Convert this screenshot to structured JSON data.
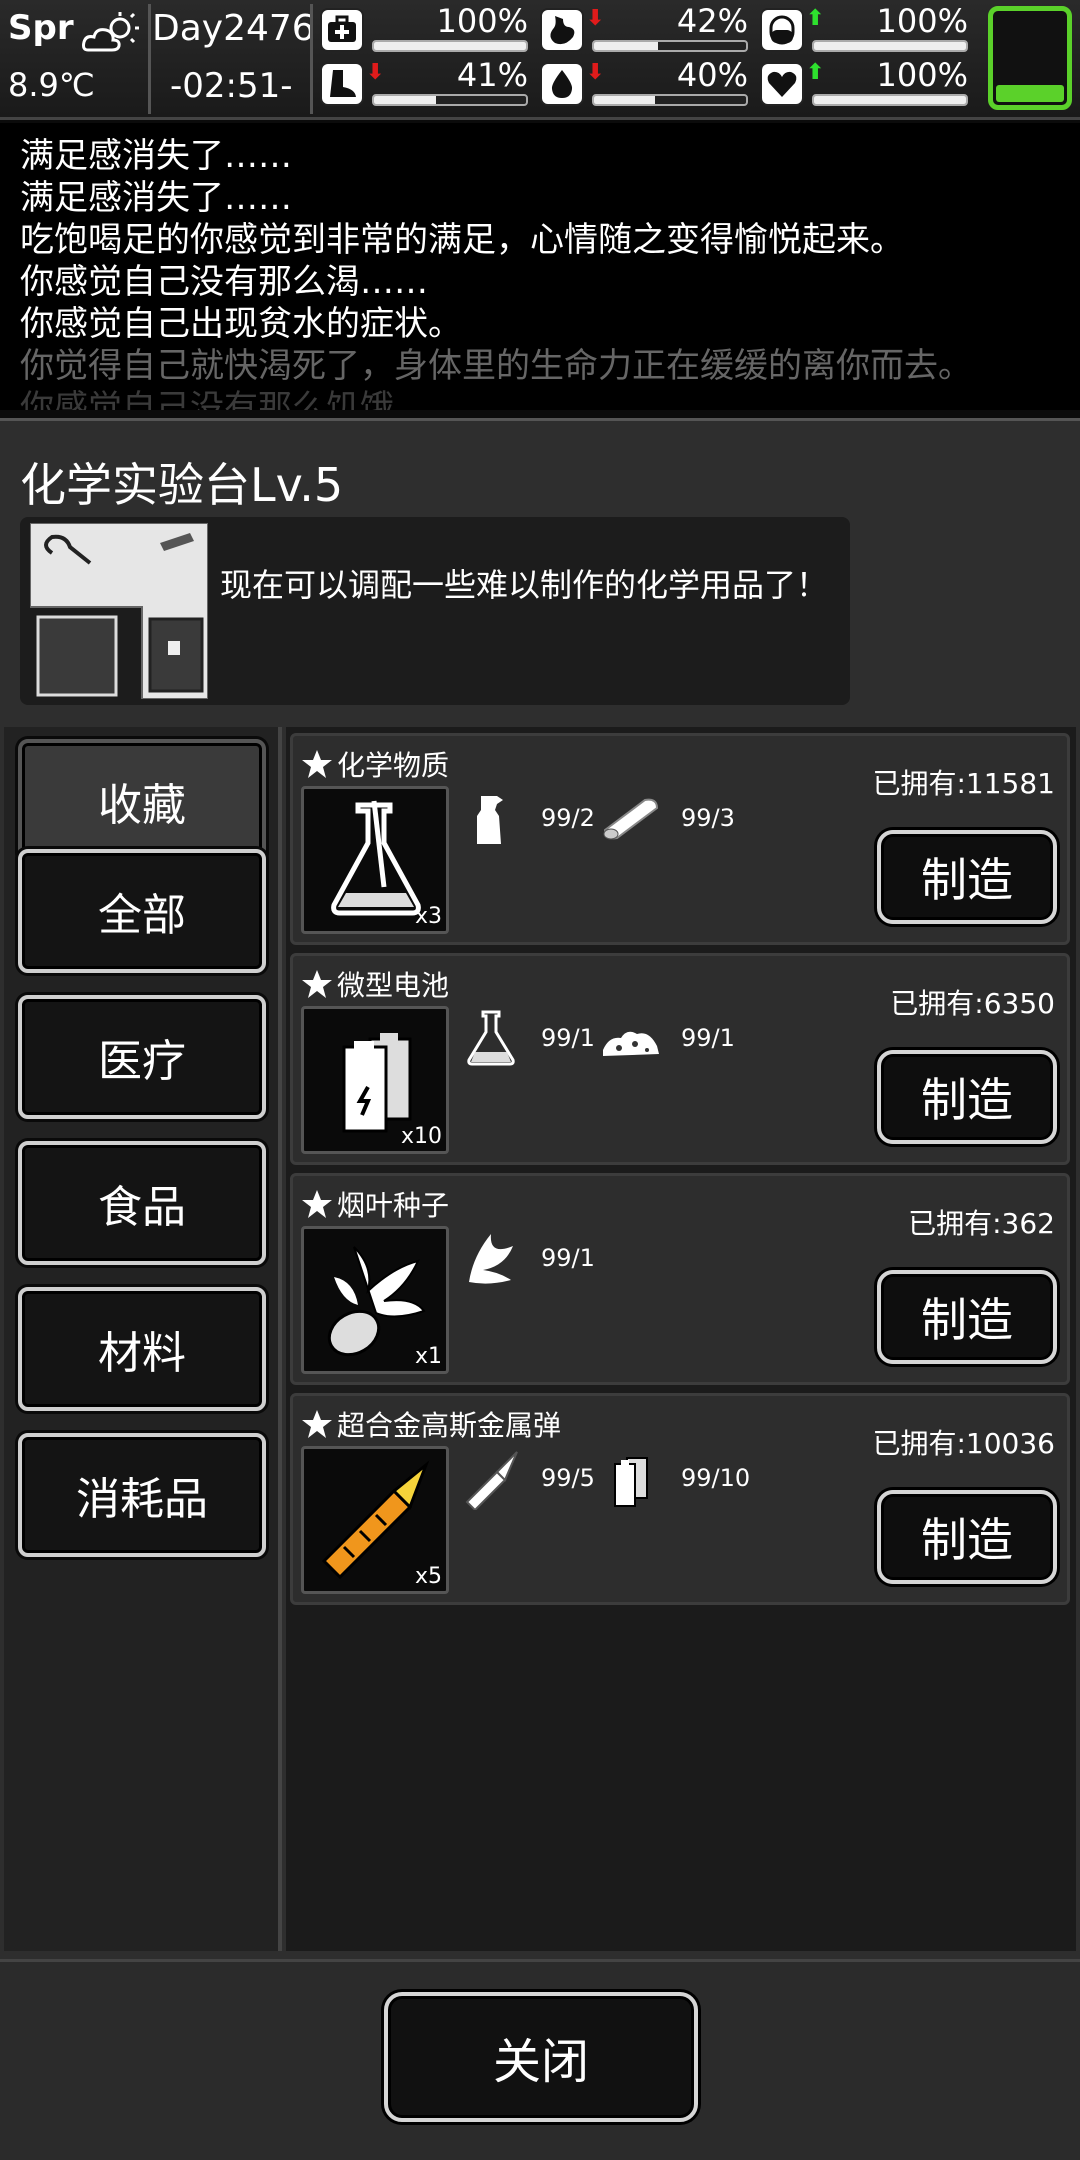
{
  "status": {
    "season": "Spr",
    "temperature": "8.9℃",
    "day": "Day2476",
    "time": "-02:51-",
    "stats": [
      {
        "name": "health",
        "value": "100%",
        "fill": 1.0,
        "trend": ""
      },
      {
        "name": "hunger",
        "value": "42%",
        "fill": 0.42,
        "trend": "down"
      },
      {
        "name": "mood",
        "value": "100%",
        "fill": 1.0,
        "trend": "up"
      },
      {
        "name": "stamina",
        "value": "41%",
        "fill": 0.41,
        "trend": "down"
      },
      {
        "name": "thirst",
        "value": "40%",
        "fill": 0.4,
        "trend": "down"
      },
      {
        "name": "heart",
        "value": "100%",
        "fill": 1.0,
        "trend": "up"
      }
    ],
    "battery_level": 0.18,
    "colors": {
      "battery": "#5bd12a",
      "up": "#2ee02e",
      "down": "#e01b1b"
    }
  },
  "log": [
    "满足感消失了……",
    "满足感消失了……",
    "吃饱喝足的你感觉到非常的满足，心情随之变得愉悦起来。",
    "你感觉自己没有那么渴……",
    "你感觉自己出现贫水的症状。",
    "你觉得自己就快渴死了，身体里的生命力正在缓缓的离你而去。",
    "你感觉自己没有那么饥饿……"
  ],
  "panel": {
    "title": "化学实验台Lv.5",
    "description": "现在可以调配一些难以制作的化学用品了！"
  },
  "categories": [
    "收藏",
    "全部",
    "医疗",
    "食品",
    "材料",
    "消耗品"
  ],
  "recipes": [
    {
      "name": "化学物质",
      "qty": "x3",
      "owned": "已拥有:11581",
      "ingredients": [
        {
          "icon": "spray-bottle-icon",
          "count": "99/2"
        },
        {
          "icon": "wood-log-icon",
          "count": "99/3"
        }
      ],
      "button": "制造"
    },
    {
      "name": "微型电池",
      "qty": "x10",
      "owned": "已拥有:6350",
      "ingredients": [
        {
          "icon": "flask-icon",
          "count": "99/1"
        },
        {
          "icon": "scrap-pile-icon",
          "count": "99/1"
        }
      ],
      "button": "制造"
    },
    {
      "name": "烟叶种子",
      "qty": "x1",
      "owned": "已拥有:362",
      "ingredients": [
        {
          "icon": "leaf-icon",
          "count": "99/1"
        }
      ],
      "button": "制造"
    },
    {
      "name": "超合金高斯金属弹",
      "qty": "x5",
      "owned": "已拥有:10036",
      "ingredients": [
        {
          "icon": "bullet-icon",
          "count": "99/5"
        },
        {
          "icon": "battery-icon",
          "count": "99/10"
        }
      ],
      "button": "制造"
    }
  ],
  "close_label": "关闭"
}
